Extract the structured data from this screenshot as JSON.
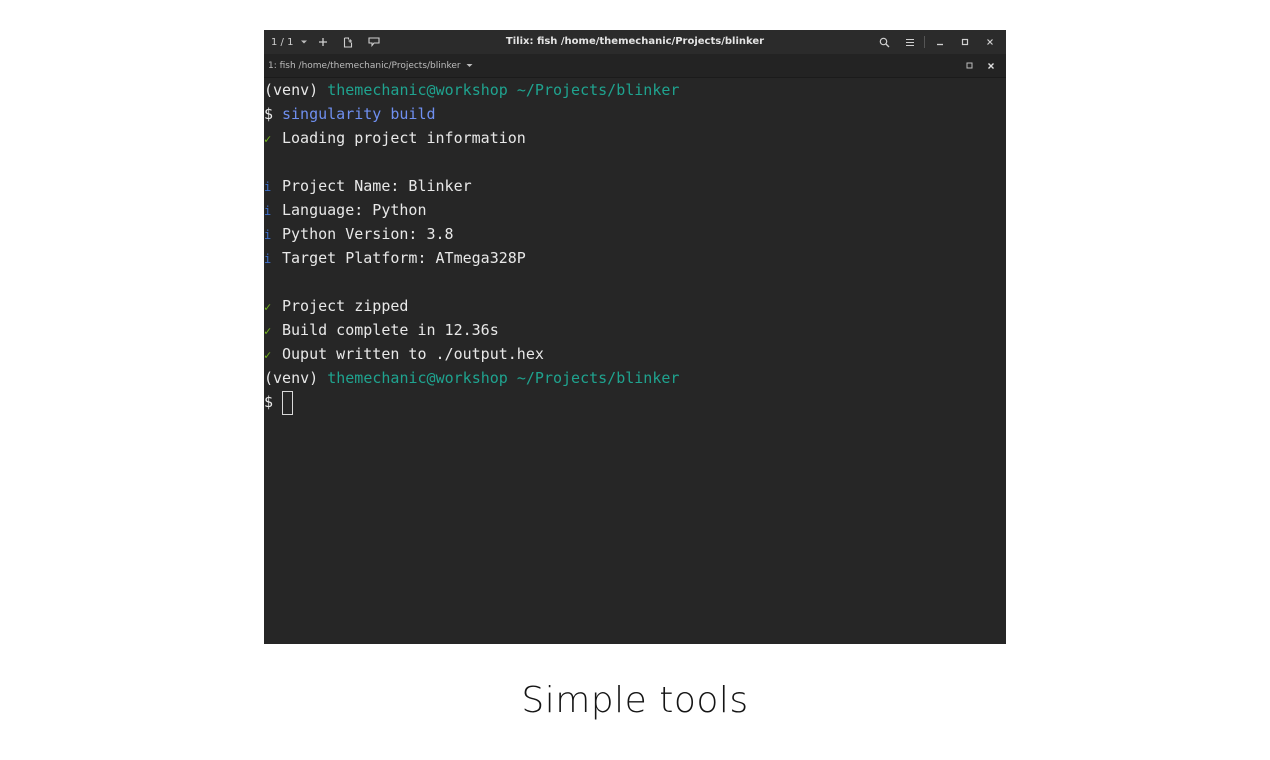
{
  "window": {
    "title": "Tilix: fish /home/themechanic/Projects/blinker",
    "session_counter": "1 / 1"
  },
  "titlebar_icons": {
    "session_dropdown": "chevron-down-icon",
    "add_terminal": "plus-icon",
    "new_session": "add-right-icon",
    "sync_input": "sync-input-icon",
    "search": "search-icon",
    "menu": "hamburger-menu-icon",
    "minimize": "minimize-icon",
    "maximize": "maximize-icon",
    "close": "close-icon"
  },
  "tab": {
    "label": "1: fish /home/themechanic/Projects/blinker"
  },
  "colors": {
    "prompt_path": "#1fa38f",
    "command": "#6f8ff0",
    "success_mark": "#73b51f",
    "info_mark": "#3e6fc8",
    "background": "#262626"
  },
  "terminal": {
    "prompt1": {
      "venv": "(venv)",
      "user_host": "themechanic@workshop",
      "path": "~/Projects/blinker"
    },
    "command_line": {
      "dollar": "$",
      "command": "singularity build"
    },
    "output": [
      {
        "mark": "✓",
        "kind": "ok",
        "text": "Loading project information"
      },
      {
        "mark": "i",
        "kind": "info",
        "text": "Project Name: Blinker"
      },
      {
        "mark": "i",
        "kind": "info",
        "text": "Language: Python"
      },
      {
        "mark": "i",
        "kind": "info",
        "text": "Python Version: 3.8"
      },
      {
        "mark": "i",
        "kind": "info",
        "text": "Target Platform: ATmega328P"
      },
      {
        "mark": "✓",
        "kind": "ok",
        "text": "Project zipped"
      },
      {
        "mark": "✓",
        "kind": "ok",
        "text": "Build complete in 12.36s"
      },
      {
        "mark": "✓",
        "kind": "ok",
        "text": "Ouput written to ./output.hex"
      }
    ],
    "prompt2": {
      "venv": "(venv)",
      "user_host": "themechanic@workshop",
      "path": "~/Projects/blinker"
    },
    "input_line": {
      "dollar": "$"
    }
  },
  "caption": "Simple tools"
}
